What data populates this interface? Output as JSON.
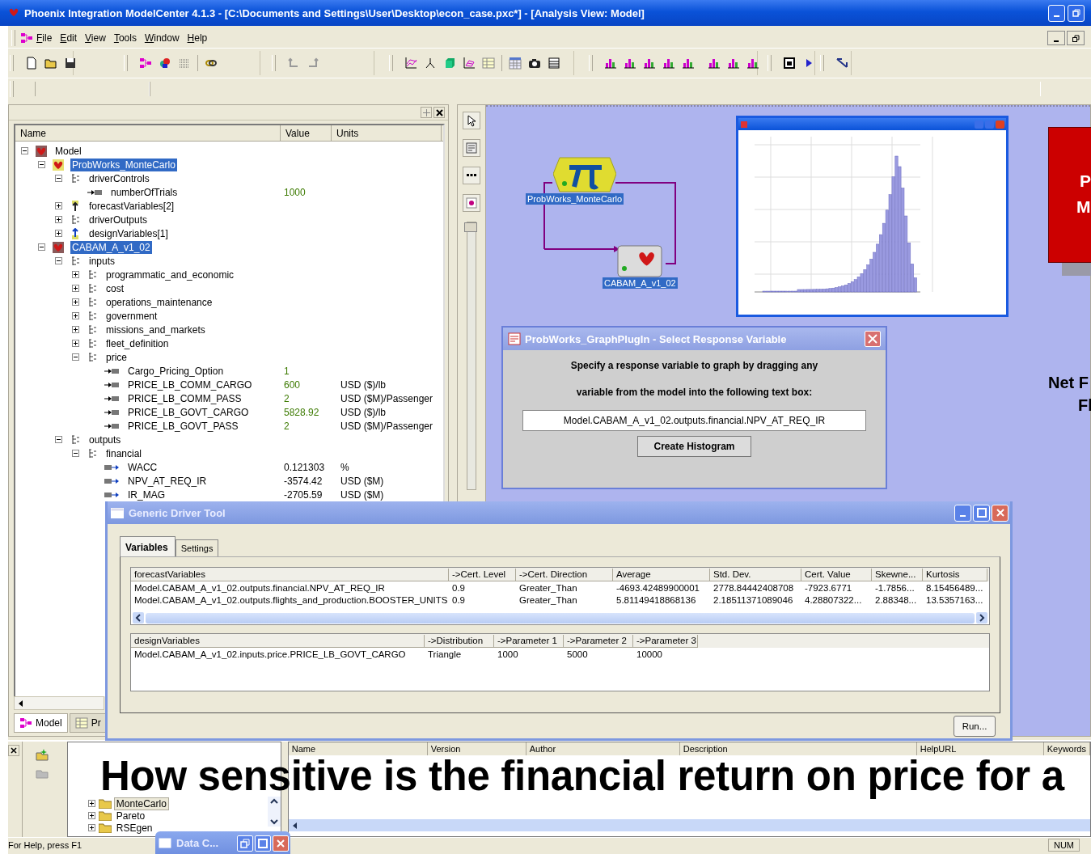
{
  "window": {
    "title": "Phoenix Integration ModelCenter 4.1.3 - [C:\\Documents and Settings\\User\\Desktop\\econ_case.pxc*] - [Analysis View: Model]"
  },
  "menu": [
    "File",
    "Edit",
    "View",
    "Tools",
    "Window",
    "Help"
  ],
  "model_tree": {
    "columns": [
      "Name",
      "Value",
      "Units"
    ],
    "rows": [
      {
        "name": "Model",
        "kind": "model",
        "expanded": true,
        "selected": false,
        "children": [
          {
            "name": "ProbWorks_MonteCarlo",
            "kind": "driver",
            "expanded": true,
            "selected": true,
            "children": [
              {
                "name": "driverControls",
                "kind": "group",
                "expanded": true,
                "selected": false,
                "children": [
                  {
                    "name": "numberOfTrials",
                    "kind": "input",
                    "selected": false,
                    "value": "1000"
                  }
                ]
              },
              {
                "name": "forecastVariables[2]",
                "kind": "forecast",
                "expanded": false,
                "selected": false
              },
              {
                "name": "driverOutputs",
                "kind": "group",
                "expanded": false,
                "selected": false
              },
              {
                "name": "designVariables[1]",
                "kind": "design",
                "expanded": false,
                "selected": false
              }
            ]
          },
          {
            "name": "CABAM_A_v1_02",
            "kind": "component",
            "expanded": true,
            "selected": true,
            "children": [
              {
                "name": "inputs",
                "kind": "group",
                "expanded": true,
                "selected": false,
                "children": [
                  {
                    "name": "programmatic_and_economic",
                    "kind": "group",
                    "expanded": false,
                    "selected": false
                  },
                  {
                    "name": "cost",
                    "kind": "group",
                    "expanded": false,
                    "selected": false
                  },
                  {
                    "name": "operations_maintenance",
                    "kind": "group",
                    "expanded": false,
                    "selected": false
                  },
                  {
                    "name": "government",
                    "kind": "group",
                    "expanded": false,
                    "selected": false
                  },
                  {
                    "name": "missions_and_markets",
                    "kind": "group",
                    "expanded": false,
                    "selected": false
                  },
                  {
                    "name": "fleet_definition",
                    "kind": "group",
                    "expanded": false,
                    "selected": false
                  },
                  {
                    "name": "price",
                    "kind": "group",
                    "expanded": true,
                    "selected": false,
                    "children": [
                      {
                        "name": "Cargo_Pricing_Option",
                        "kind": "input",
                        "selected": false,
                        "value": "1"
                      },
                      {
                        "name": "PRICE_LB_COMM_CARGO",
                        "kind": "input",
                        "selected": false,
                        "value": "600",
                        "units": "USD ($)/lb"
                      },
                      {
                        "name": "PRICE_LB_COMM_PASS",
                        "kind": "input",
                        "selected": false,
                        "value": "2",
                        "units": "USD ($M)/Passenger"
                      },
                      {
                        "name": "PRICE_LB_GOVT_CARGO",
                        "kind": "input",
                        "selected": false,
                        "value": "5828.92",
                        "units": "USD ($)/lb"
                      },
                      {
                        "name": "PRICE_LB_GOVT_PASS",
                        "kind": "input",
                        "selected": false,
                        "value": "2",
                        "units": "USD ($M)/Passenger"
                      }
                    ]
                  }
                ]
              },
              {
                "name": "outputs",
                "kind": "group",
                "expanded": true,
                "selected": false,
                "children": [
                  {
                    "name": "financial",
                    "kind": "group",
                    "expanded": true,
                    "selected": false,
                    "children": [
                      {
                        "name": "WACC",
                        "kind": "output",
                        "selected": false,
                        "value": "0.121303",
                        "units": "%"
                      },
                      {
                        "name": "NPV_AT_REQ_IR",
                        "kind": "output",
                        "selected": false,
                        "value": "-3574.42",
                        "units": "USD ($M)"
                      },
                      {
                        "name": "IR_MAG",
                        "kind": "output",
                        "selected": false,
                        "value": "-2705.59",
                        "units": "USD ($M)"
                      }
                    ]
                  }
                ]
              }
            ]
          }
        ]
      }
    ]
  },
  "panel_tabs": [
    {
      "label": "Model",
      "selected": true
    },
    {
      "label": "Pr",
      "selected": false
    }
  ],
  "canvas": {
    "zoom_slider": {
      "level": 1
    },
    "nodes": [
      {
        "label": "ProbWorks_MonteCarlo",
        "kind": "driver",
        "selected": true
      },
      {
        "label": "CABAM_A_v1_02",
        "kind": "component",
        "selected": true
      }
    ]
  },
  "slide_overlay": {
    "box_lines": [
      "P",
      "M"
    ],
    "caption_lines": [
      "Net F",
      "Fl"
    ],
    "headline": "How sensitive is the financial return on price for a"
  },
  "response_dialog": {
    "title": "ProbWorks_GraphPlugIn - Select Response Variable",
    "instructions": [
      "Specify a response variable to graph by dragging any",
      "variable from the model into the following text box:"
    ],
    "field_value": "Model.CABAM_A_v1_02.outputs.financial.NPV_AT_REQ_IR",
    "button": "Create Histogram"
  },
  "driver_tool": {
    "title": "Generic Driver Tool",
    "tabs": [
      {
        "label": "Variables",
        "selected": true
      },
      {
        "label": "Settings",
        "selected": false
      }
    ],
    "forecast_table": {
      "columns": [
        "forecastVariables",
        "->Cert. Level",
        "->Cert. Direction",
        "Average",
        "Std. Dev.",
        "Cert. Value",
        "Skewne...",
        "Kurtosis"
      ],
      "rows": [
        [
          "Model.CABAM_A_v1_02.outputs.financial.NPV_AT_REQ_IR",
          "0.9",
          "Greater_Than",
          "-4693.42489900001",
          "2778.84442408708",
          "-7923.6771",
          "-1.7856...",
          "8.15456489..."
        ],
        [
          "Model.CABAM_A_v1_02.outputs.flights_and_production.BOOSTER_UNITS",
          "0.9",
          "Greater_Than",
          "5.81149418868136",
          "2.18511371089046",
          "4.28807322...",
          "2.88348...",
          "13.5357163..."
        ]
      ]
    },
    "design_table": {
      "columns": [
        "designVariables",
        "->Distribution",
        "->Parameter 1",
        "->Parameter 2",
        "->Parameter 3"
      ],
      "rows": [
        [
          "Model.CABAM_A_v1_02.inputs.price.PRICE_LB_GOVT_CARGO",
          "Triangle",
          "1000",
          "5000",
          "10000"
        ]
      ]
    },
    "run_button": "Run..."
  },
  "library": {
    "folders": [
      {
        "label": "MonteCarlo",
        "selected": true
      },
      {
        "label": "Pareto",
        "selected": false
      },
      {
        "label": "RSEgen",
        "selected": false
      }
    ],
    "columns": [
      "Name",
      "Version",
      "Author",
      "Description",
      "HelpURL",
      "Keywords"
    ]
  },
  "minimized_window": {
    "title": "Data C..."
  },
  "status_bar": {
    "help": "For Help, press F1",
    "indicators": [
      "NUM"
    ]
  }
}
